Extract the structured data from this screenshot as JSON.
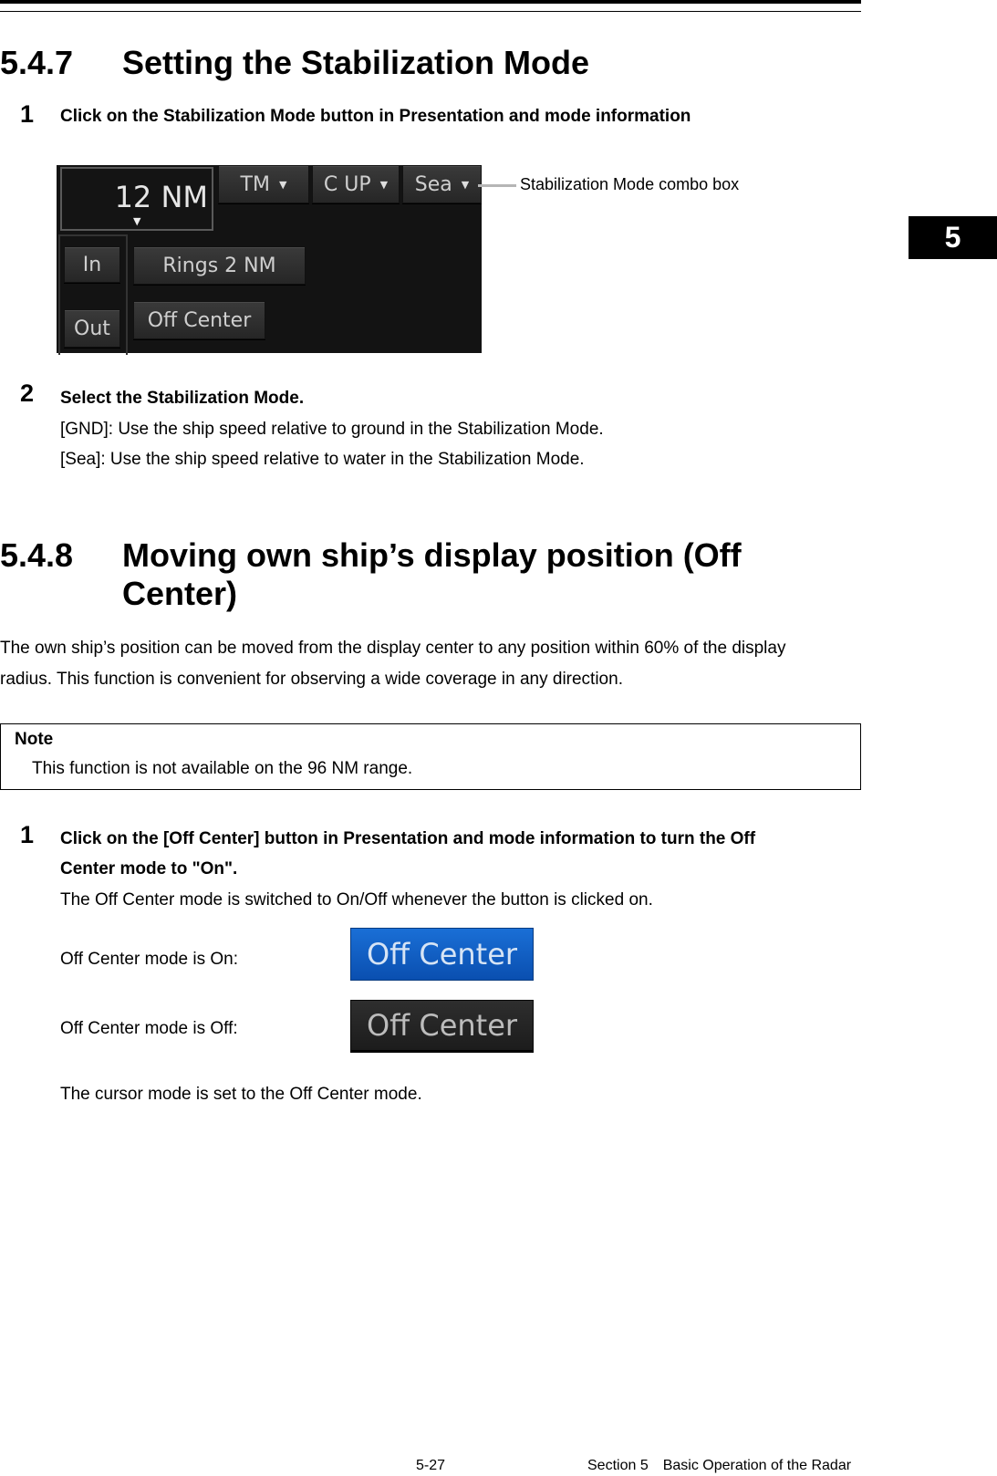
{
  "chapter_tab": "5",
  "section_547": {
    "number": "5.4.7",
    "title": "Setting the Stabilization Mode",
    "step1": {
      "num": "1",
      "title": "Click on the Stabilization Mode button in Presentation and mode information"
    },
    "radar_panel": {
      "range": "12 NM",
      "motion_mode": "TM",
      "orientation": "C UP",
      "stabilization": "Sea",
      "zoom_in": "In",
      "zoom_out": "Out",
      "rings": "Rings 2 NM",
      "off_center": "Off Center"
    },
    "callout": "Stabilization Mode combo box",
    "step2": {
      "num": "2",
      "title": "Select the Stabilization Mode.",
      "lines": [
        "[GND]: Use the ship speed relative to ground in the Stabilization Mode.",
        "[Sea]: Use the ship speed relative to water in the Stabilization Mode."
      ]
    }
  },
  "section_548": {
    "number": "5.4.8",
    "title_line1": "Moving own ship’s display position (Off",
    "title_line2": "Center)",
    "intro_line1": "The own ship’s position can be moved from the display center to any position within 60% of the display",
    "intro_line2": "radius. This function is convenient for observing a wide coverage in any direction.",
    "note": {
      "title": "Note",
      "text": "This function is not available on the 96 NM range."
    },
    "step1": {
      "num": "1",
      "title_line1": "Click on the [Off Center] button in Presentation and mode information to turn the Off",
      "title_line2": "Center mode to \"On\".",
      "desc": "The Off Center mode is switched to On/Off whenever the button is clicked on.",
      "on_label": "Off Center mode is On:",
      "off_label": "Off Center mode is Off:",
      "button_label": "Off Center",
      "after": "The cursor mode is set to the Off Center mode."
    }
  },
  "footer": {
    "page": "5-27",
    "section": "Section 5 Basic Operation of the Radar"
  }
}
